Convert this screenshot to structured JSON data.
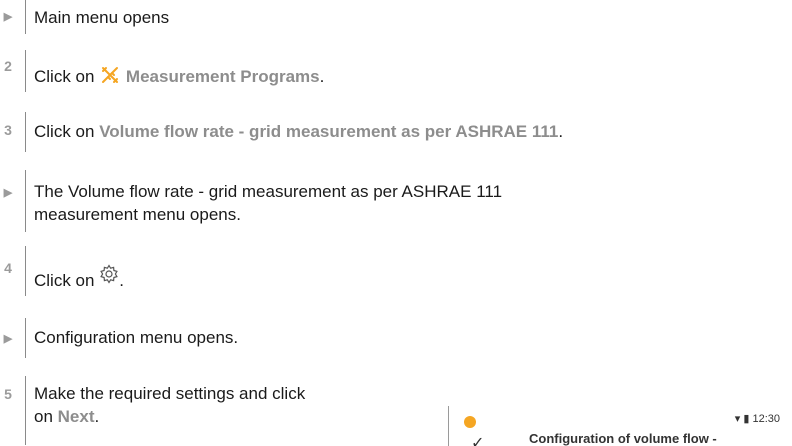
{
  "steps": [
    {
      "marker": "▶",
      "text": "Main menu opens"
    },
    {
      "marker": "2",
      "prefix": "Click on ",
      "icon": "measurement-programs-icon",
      "link": "Measurement Programs",
      "suffix": "."
    },
    {
      "marker": "3",
      "prefix": "Click on ",
      "link": "Volume flow rate - grid measurement as per ASHRAE 111",
      "suffix": "."
    },
    {
      "marker": "▶",
      "line1": "The Volume flow rate - grid measurement as per ASHRAE 111",
      "line2": "measurement menu opens."
    },
    {
      "marker": "4",
      "prefix": "Click on ",
      "icon": "gear-icon",
      "suffix": "."
    },
    {
      "marker": "▶",
      "text": "Configuration menu opens."
    },
    {
      "marker": "5",
      "line1": "Make the required settings and click",
      "line2_prefix": "on ",
      "link": "Next",
      "suffix": "."
    }
  ],
  "phone": {
    "status": "▾ ▮ 12:30",
    "back": "✓",
    "title": "Configuration of volume flow -"
  },
  "colors": {
    "accent": "#f5a623",
    "highlight": "#8d8d8d",
    "marker": "#9b9b9b"
  }
}
